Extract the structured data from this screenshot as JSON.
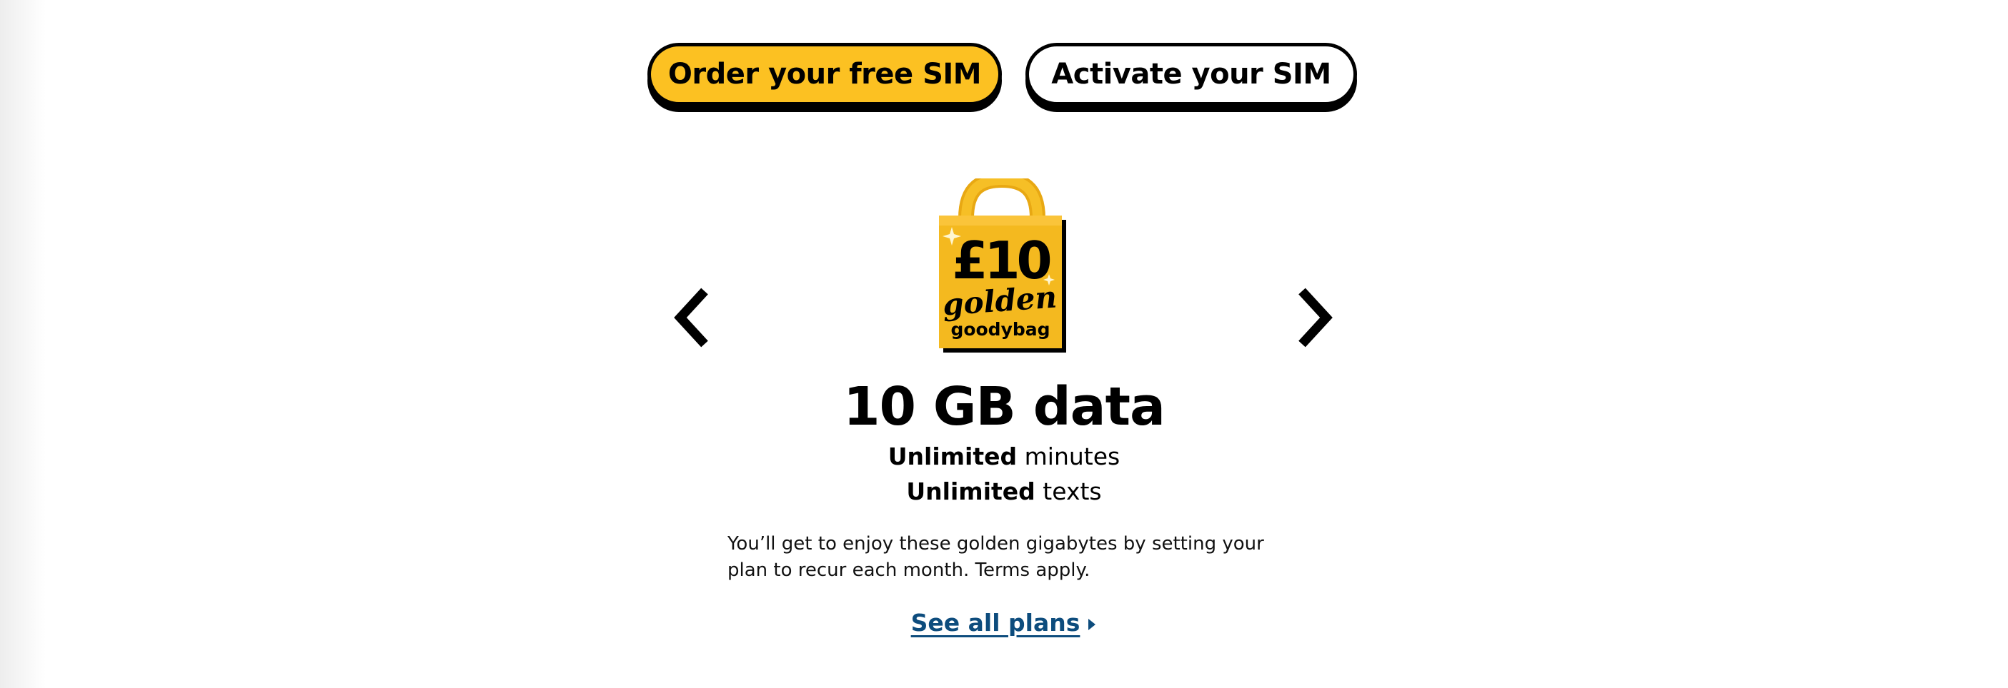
{
  "cta": {
    "order_label": "Order your free SIM",
    "activate_label": "Activate your SIM"
  },
  "offer": {
    "bag": {
      "price": "£10",
      "word1": "golden",
      "word2": "goodybag"
    },
    "headline": "10 GB data",
    "features": [
      {
        "bold": "Unlimited",
        "rest": "minutes"
      },
      {
        "bold": "Unlimited",
        "rest": "texts"
      }
    ],
    "description": "You’ll get to enjoy these golden gigabytes by setting your plan to recur each month. Terms apply.",
    "link_label": "See all plans"
  },
  "icons": {
    "prev": "chevron-left-icon",
    "next": "chevron-right-icon",
    "link_caret": "caret-right-icon"
  },
  "colors": {
    "brand_yellow": "#fcc122",
    "link_blue": "#0d4c7d",
    "text": "#000000"
  }
}
